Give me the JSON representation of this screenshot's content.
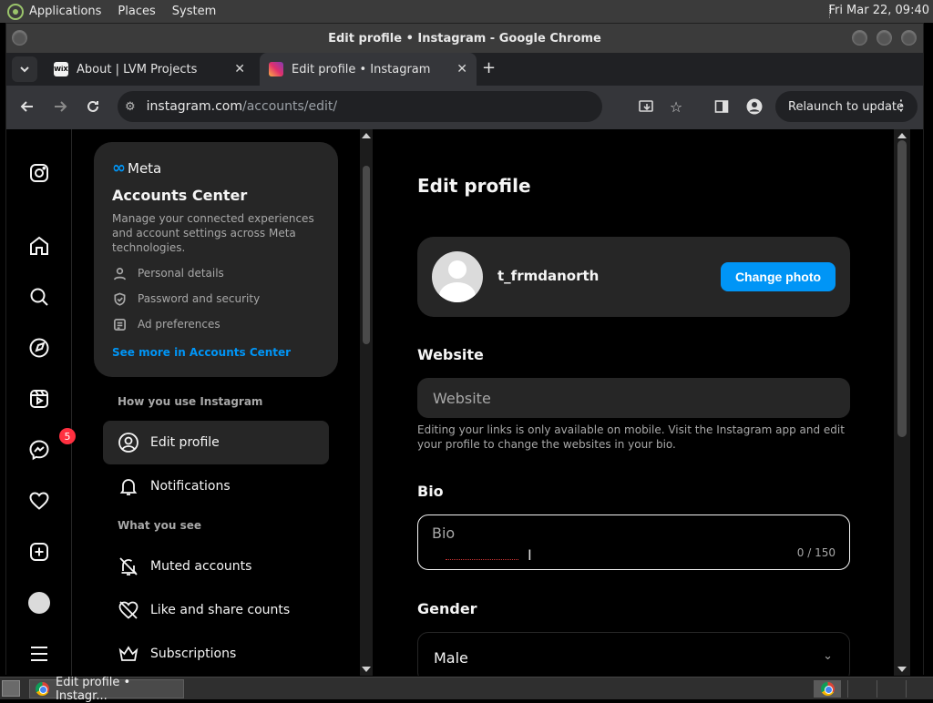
{
  "system_panel": {
    "menus": [
      "Applications",
      "Places",
      "System"
    ],
    "clock": "Fri Mar 22, 09:40"
  },
  "window": {
    "title": "Edit profile • Instagram - Google Chrome"
  },
  "tabs": [
    {
      "title": "About | LVM Projects",
      "favicon": "wix-icon",
      "active": false
    },
    {
      "title": "Edit profile • Instagram",
      "favicon": "instagram-icon",
      "active": true
    }
  ],
  "toolbar": {
    "url_host": "instagram.com",
    "url_path": "/accounts/edit/",
    "relaunch_label": "Relaunch to update"
  },
  "rail": {
    "messages_badge": "5",
    "icons": [
      "instagram-logo-icon",
      "home-icon",
      "search-icon",
      "explore-icon",
      "reels-icon",
      "messenger-icon",
      "heart-icon",
      "create-icon",
      "profile-avatar",
      "menu-icon"
    ]
  },
  "accounts_center": {
    "brand": "Meta",
    "title": "Accounts Center",
    "description": "Manage your connected experiences and account settings across Meta technologies.",
    "items": [
      {
        "label": "Personal details",
        "icon": "person-icon"
      },
      {
        "label": "Password and security",
        "icon": "shield-icon"
      },
      {
        "label": "Ad preferences",
        "icon": "ad-icon"
      }
    ],
    "link": "See more in Accounts Center"
  },
  "settings": {
    "section1": "How you use Instagram",
    "edit_profile": "Edit profile",
    "notifications": "Notifications",
    "section2": "What you see",
    "muted": "Muted accounts",
    "like_share": "Like and share counts",
    "subscriptions": "Subscriptions"
  },
  "main": {
    "title": "Edit profile",
    "username": "t_frmdanorth",
    "change_photo": "Change photo",
    "website_label": "Website",
    "website_placeholder": "Website",
    "website_help": "Editing your links is only available on mobile. Visit the Instagram app and edit your profile to change the websites in your bio.",
    "bio_label": "Bio",
    "bio_placeholder": "Bio",
    "bio_count": "0 / 150",
    "gender_label": "Gender",
    "gender_value": "Male"
  },
  "taskbar": {
    "task_label": "Edit profile • Instagr..."
  }
}
